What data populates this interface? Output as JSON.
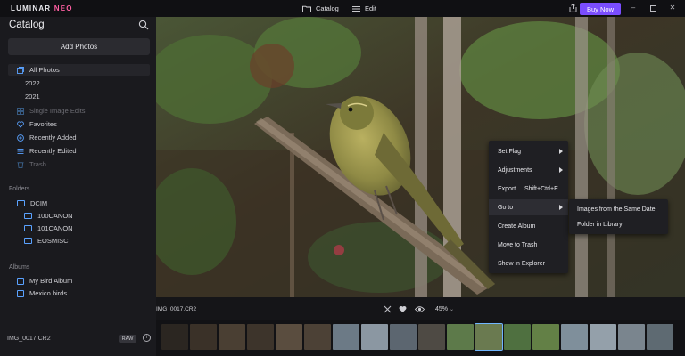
{
  "app": {
    "logo_main": "LUMINAR",
    "logo_suffix": "NEO",
    "tabs": [
      {
        "label": "Catalog",
        "icon": "folder-icon"
      },
      {
        "label": "Edit",
        "icon": "sliders-icon"
      }
    ],
    "buy_label": "Buy Now",
    "window_controls": [
      "minimize",
      "maximize",
      "close"
    ]
  },
  "sidebar": {
    "title": "Catalog",
    "add_photos": "Add Photos",
    "items": [
      {
        "label": "All Photos",
        "icon": "photos-icon",
        "active": true
      },
      {
        "label": "2022",
        "icon": ""
      },
      {
        "label": "2021",
        "icon": ""
      },
      {
        "label": "Single Image Edits",
        "icon": "grid-icon",
        "dim": true
      },
      {
        "label": "Favorites",
        "icon": "heart-icon"
      },
      {
        "label": "Recently Added",
        "icon": "plus-circle-icon"
      },
      {
        "label": "Recently Edited",
        "icon": "edit-list-icon"
      },
      {
        "label": "Trash",
        "icon": "trash-icon",
        "dim": true
      }
    ],
    "folders_title": "Folders",
    "folders": [
      "DCIM",
      "100CANON",
      "101CANON",
      "EOSMISC"
    ],
    "albums_title": "Albums",
    "albums": [
      "My Bird Album",
      "Mexico birds"
    ],
    "footer_file": "IMG_0017.CR2",
    "footer_badge": "RAW"
  },
  "viewer": {
    "image_name": "IMG_0017.CR2",
    "zoom": "45%"
  },
  "context_menu": {
    "items": [
      {
        "label": "Set Flag",
        "submenu": true
      },
      {
        "label": "Adjustments",
        "submenu": true
      },
      {
        "label": "Export...",
        "shortcut": "Shift+Ctrl+E"
      },
      {
        "label": "Go to",
        "submenu": true,
        "highlighted": true
      },
      {
        "label": "Create Album"
      },
      {
        "label": "Move to Trash"
      },
      {
        "label": "Show in Explorer"
      }
    ],
    "submenu_items": [
      "Images from the Same Date",
      "Folder in Library"
    ]
  },
  "colors": {
    "accent": "#7a4dff",
    "folder_icon": "#5aa2ff",
    "selection": "#6fb5ff"
  }
}
